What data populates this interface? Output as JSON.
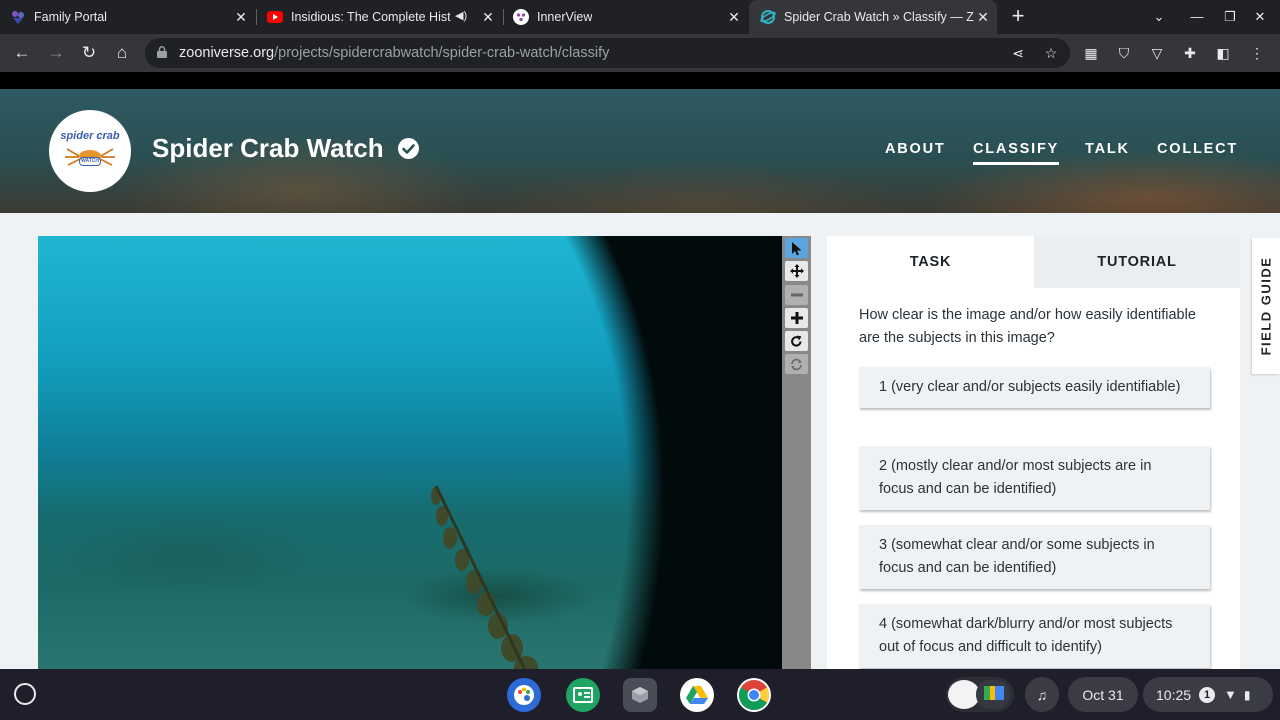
{
  "browser": {
    "tabs": [
      {
        "title": "Family Portal",
        "favicon": "family-portal-icon"
      },
      {
        "title": "Insidious: The Complete Hist",
        "favicon": "youtube-icon",
        "audio": "speaker-icon"
      },
      {
        "title": "InnerView",
        "favicon": "innerview-icon"
      },
      {
        "title": "Spider Crab Watch » Classify — Z",
        "favicon": "zooniverse-icon",
        "active": true
      }
    ],
    "url_host": "zooniverse.org",
    "url_path": "/projects/spidercrabwatch/spider-crab-watch/classify"
  },
  "project": {
    "logo_text_top": "spider crab",
    "logo_text_bottom": "WATCH",
    "title": "Spider Crab Watch",
    "nav": [
      "ABOUT",
      "CLASSIFY",
      "TALK",
      "COLLECT"
    ],
    "active_nav": "CLASSIFY"
  },
  "task_panel": {
    "tab_task": "TASK",
    "tab_tutorial": "TUTORIAL",
    "question": "How clear is the image and/or how easily identifiable are the subjects in this image?",
    "answers": [
      "1 (very clear and/or subjects easily identifiable)",
      "2 (mostly clear and/or most subjects are in focus and can be identified)",
      "3 (somewhat clear and/or some subjects in focus and can be identified)",
      "4 (somewhat dark/blurry and/or most subjects out of focus and difficult to identify)"
    ]
  },
  "field_guide": "FIELD GUIDE",
  "shelf": {
    "date": "Oct 31",
    "time": "10:25",
    "notification_count": "1"
  },
  "colors": {
    "chrome_bg": "#202124",
    "toolbar_bg": "#35363a",
    "page_bg": "#eff2f5",
    "tool_selected": "#5aa5e0",
    "text_dark": "#293339"
  }
}
